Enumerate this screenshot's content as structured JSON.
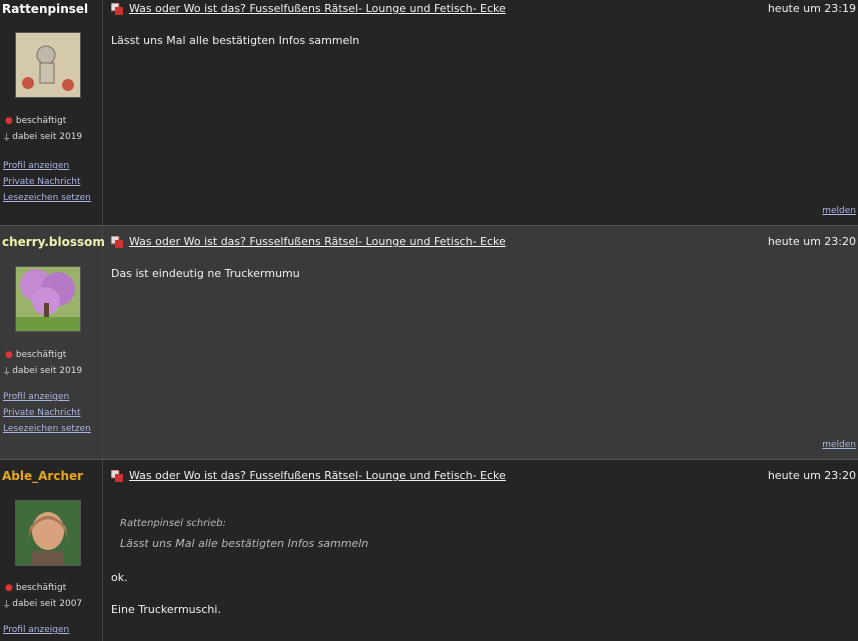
{
  "colors": {
    "dark_post_bg": "#252525",
    "gray_post_bg": "#3a3a3a",
    "link": "#a9b6e6"
  },
  "posts": [
    {
      "author": "Rattenpinsel",
      "author_color": "#ffffff",
      "status": "beschäftigt",
      "since": "dabei seit 2019",
      "links": [
        "Profil anzeigen",
        "Private Nachricht",
        "Lesezeichen setzen"
      ],
      "title": "Was oder Wo ist das? Fusselfußens Rätsel- Lounge und Fetisch- Ecke",
      "time": "heute um 23:19",
      "body": "Lässt uns Mal alle bestätigten Infos sammeln",
      "report": "melden"
    },
    {
      "author": "cherry.blossom",
      "author_color": "#f2f2b0",
      "status": "beschäftigt",
      "since": "dabei seit 2019",
      "links": [
        "Profil anzeigen",
        "Private Nachricht",
        "Lesezeichen setzen"
      ],
      "title": "Was oder Wo ist das? Fusselfußens Rätsel- Lounge und Fetisch- Ecke",
      "time": "heute um 23:20",
      "body": "Das ist eindeutig ne Truckermumu",
      "report": "melden"
    },
    {
      "author": "Able_Archer",
      "author_color": "#e8a71a",
      "status": "beschäftigt",
      "since": "dabei seit 2007",
      "links": [
        "Profil anzeigen"
      ],
      "title": "Was oder Wo ist das? Fusselfußens Rätsel- Lounge und Fetisch- Ecke",
      "time": "heute um 23:20",
      "quote_author": "Rattenpinsel schrieb:",
      "quote_text": "Lässt uns Mal alle bestätigten Infos sammeln",
      "body_line1": "ok.",
      "body_line2": "Eine Truckermuschi."
    }
  ],
  "icons": {
    "post": "post-icon",
    "status": "status-dot-icon",
    "since": "member-icon"
  }
}
